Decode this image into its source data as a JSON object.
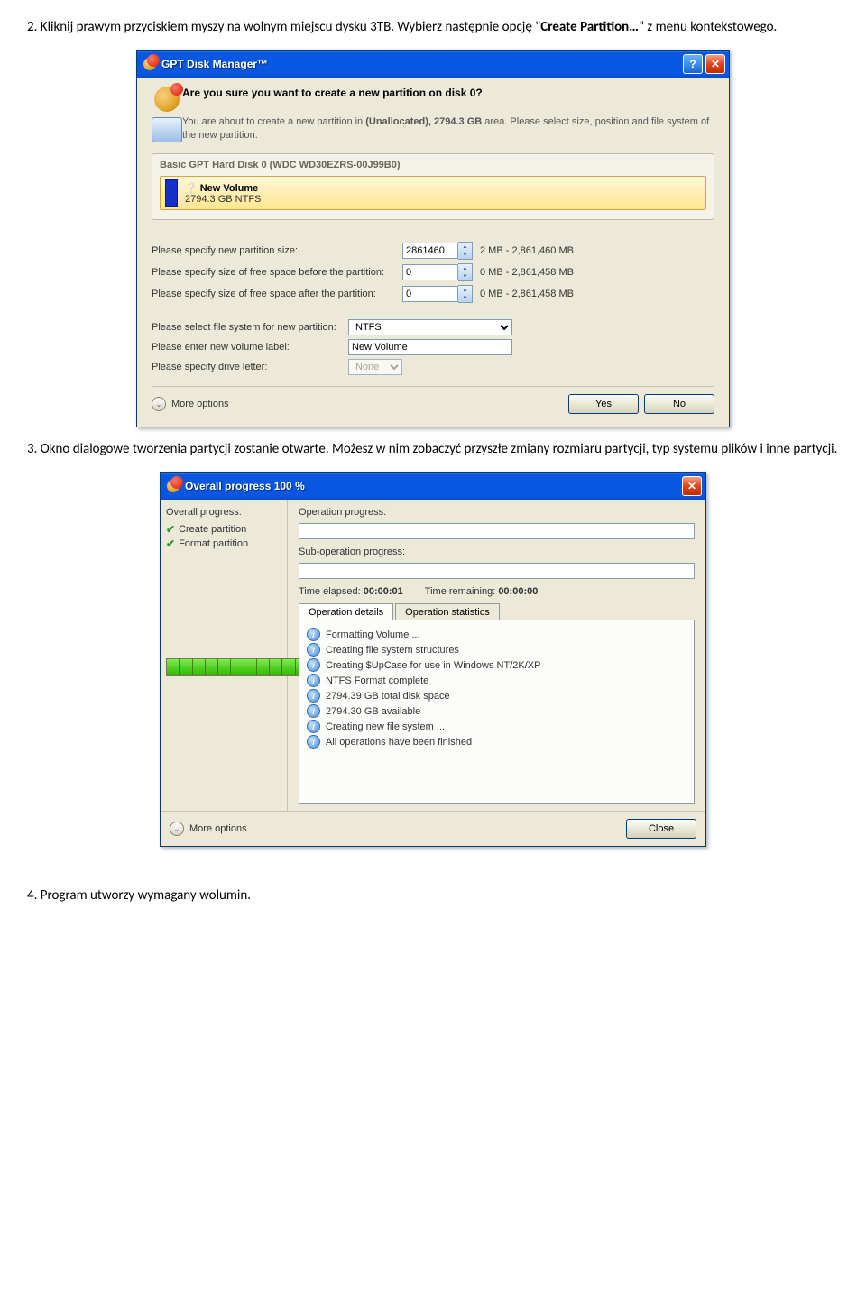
{
  "doc": {
    "p1_a": "2. Kliknij prawym przyciskiem myszy na wolnym miejscu dysku 3TB. Wybierz następnie opcję \"",
    "p1_b": "Create Partition…",
    "p1_c": "\" z menu kontekstowego.",
    "p2": "3. Okno dialogowe tworzenia partycji zostanie otwarte. Możesz w nim zobaczyć przyszłe zmiany rozmiaru partycji, typ systemu plików i inne partycji.",
    "p3": "4. Program utworzy wymagany wolumin."
  },
  "w1": {
    "title": "GPT Disk Manager™",
    "heading": "Are you sure you want to create a new partition on disk 0?",
    "sub_a": "You are about to create a new partition in ",
    "sub_b": "(Unallocated), 2794.3 GB",
    "sub_c": " area. Please select size, position and file system of the new partition.",
    "panel_head": "Basic GPT Hard Disk 0 (WDC WD30EZRS-00J99B0)",
    "vol_name": "New Volume",
    "vol_size": "2794.3 GB NTFS",
    "f_size_label": "Please specify new partition size:",
    "f_size_value": "2861460",
    "f_size_range": "2 MB - 2,861,460 MB",
    "f_before_label": "Please specify size of free space before the partition:",
    "f_before_value": "0",
    "f_before_range": "0 MB - 2,861,458 MB",
    "f_after_label": "Please specify size of free space after the partition:",
    "f_after_value": "0",
    "f_after_range": "0 MB - 2,861,458 MB",
    "f_fs_label": "Please select file system for new partition:",
    "f_fs_value": "NTFS",
    "f_label_label": "Please enter new volume label:",
    "f_label_value": "New Volume",
    "f_drive_label": "Please specify drive letter:",
    "f_drive_value": "None",
    "more": "More options",
    "yes": "Yes",
    "no": "No"
  },
  "w2": {
    "title": "Overall progress 100 %",
    "side_head": "Overall progress:",
    "step1": "Create partition",
    "step2": "Format partition",
    "op_label": "Operation progress:",
    "sub_label": "Sub-operation progress:",
    "time_e_l": "Time elapsed:",
    "time_e_v": "00:00:01",
    "time_r_l": "Time remaining:",
    "time_r_v": "00:00:00",
    "tab1": "Operation details",
    "tab2": "Operation statistics",
    "d1": "Formatting Volume ...",
    "d2": "Creating file system structures",
    "d3": "Creating $UpCase for use in Windows NT/2K/XP",
    "d4": "NTFS Format complete",
    "d5": "2794.39 GB total disk space",
    "d6": "2794.30 GB available",
    "d7": "Creating new file system ...",
    "d8": "All operations have been finished",
    "more": "More options",
    "close": "Close"
  }
}
